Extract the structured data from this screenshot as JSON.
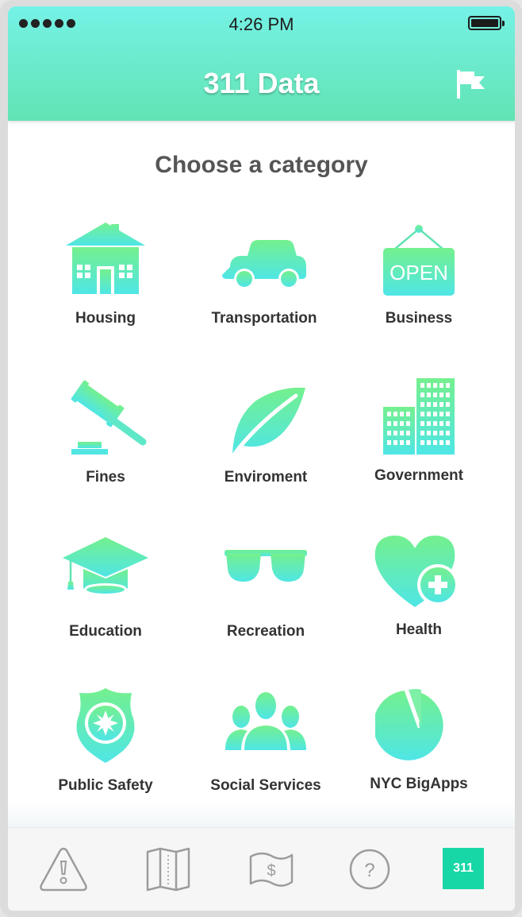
{
  "status_bar": {
    "time": "4:26 PM",
    "signal_dots": 5,
    "battery_icon": "battery-full-icon"
  },
  "header": {
    "title": "311 Data",
    "action_icon": "flag-icon"
  },
  "subtitle": "Choose a category",
  "categories": [
    {
      "label": "Housing",
      "icon": "house-icon"
    },
    {
      "label": "Transportation",
      "icon": "car-icon"
    },
    {
      "label": "Business",
      "icon": "open-sign-icon",
      "icon_text": "OPEN"
    },
    {
      "label": "Fines",
      "icon": "gavel-icon"
    },
    {
      "label": "Enviroment",
      "icon": "leaf-icon"
    },
    {
      "label": "Government",
      "icon": "buildings-icon"
    },
    {
      "label": "Education",
      "icon": "graduation-cap-icon"
    },
    {
      "label": "Recreation",
      "icon": "sunglasses-icon"
    },
    {
      "label": "Health",
      "icon": "heart-plus-icon"
    },
    {
      "label": "Public Safety",
      "icon": "police-badge-icon"
    },
    {
      "label": "Social Services",
      "icon": "people-icon"
    },
    {
      "label": "NYC BigApps",
      "icon": "pie-chart-icon"
    }
  ],
  "tabbar": {
    "items": [
      {
        "icon": "warning-icon"
      },
      {
        "icon": "map-icon"
      },
      {
        "icon": "money-icon"
      },
      {
        "icon": "help-icon"
      },
      {
        "icon": "311-icon",
        "label": "311",
        "active": true
      }
    ]
  },
  "colors": {
    "gradient_top": "#75f2e6",
    "gradient_bottom": "#62e3b3",
    "icon_gradient_top": "#6ff0a0",
    "icon_gradient_bottom": "#52e6e2",
    "active_tab": "#18d7a6"
  }
}
